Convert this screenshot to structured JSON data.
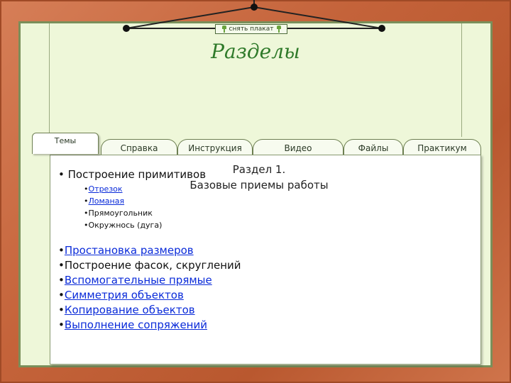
{
  "poster_button": {
    "label": "снять плакат"
  },
  "page_title": "Разделы",
  "tabs": [
    {
      "label": "Темы",
      "active": true
    },
    {
      "label": "Справка",
      "active": false
    },
    {
      "label": "Инструкция",
      "active": false
    },
    {
      "label": "Видео",
      "active": false
    },
    {
      "label": "Файлы",
      "active": false
    },
    {
      "label": "Практикум",
      "active": false
    }
  ],
  "section": {
    "line1": "Раздел 1.",
    "line2": "Базовые приемы работы"
  },
  "topics": {
    "primitives": "Построение примитивов",
    "primitives_sub": [
      "Отрезок",
      "Ломаная",
      "Прямоугольник",
      "Окружнось (дуга)"
    ],
    "items": [
      "Простановка размеров",
      "Построение фасок, скруглений",
      "Вспомогательные прямые",
      "Симметрия объектов",
      "Копирование объектов",
      "Выполнение сопряжений"
    ]
  },
  "colors": {
    "frame": "#c4633a",
    "board": "#eef7d9",
    "title": "#2f7a2a",
    "link": "#0a2bd9"
  }
}
